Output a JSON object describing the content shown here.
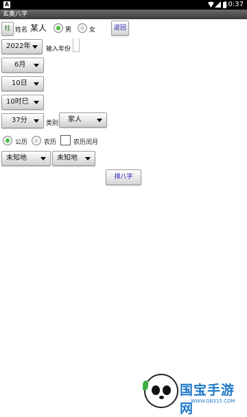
{
  "status_bar": {
    "app_badge": "A",
    "time": "10:37"
  },
  "title_bar": {
    "title": "玄奥八字"
  },
  "form": {
    "pillar_button": "柱",
    "name_label": "姓名",
    "name_value": "某人",
    "gender": {
      "male": "男",
      "female": "女",
      "selected": "male"
    },
    "back_button": "返回",
    "year_select": "2022年",
    "year_input_label": "输入年份",
    "month_select": "6月",
    "day_select": "10日",
    "hour_select": "10时巳",
    "minute_select": "37分",
    "category_label": "类别",
    "category_select": "家人",
    "calendar": {
      "solar": "公历",
      "lunar": "农历",
      "selected": "solar"
    },
    "leap_month_label": "农历闰月",
    "leap_month_checked": false,
    "place_select_1": "未知地",
    "place_select_2": "未知地",
    "submit_button": "排八字"
  },
  "watermark": {
    "brand": "国宝手游网",
    "url": "WWW.GB315.COM"
  }
}
